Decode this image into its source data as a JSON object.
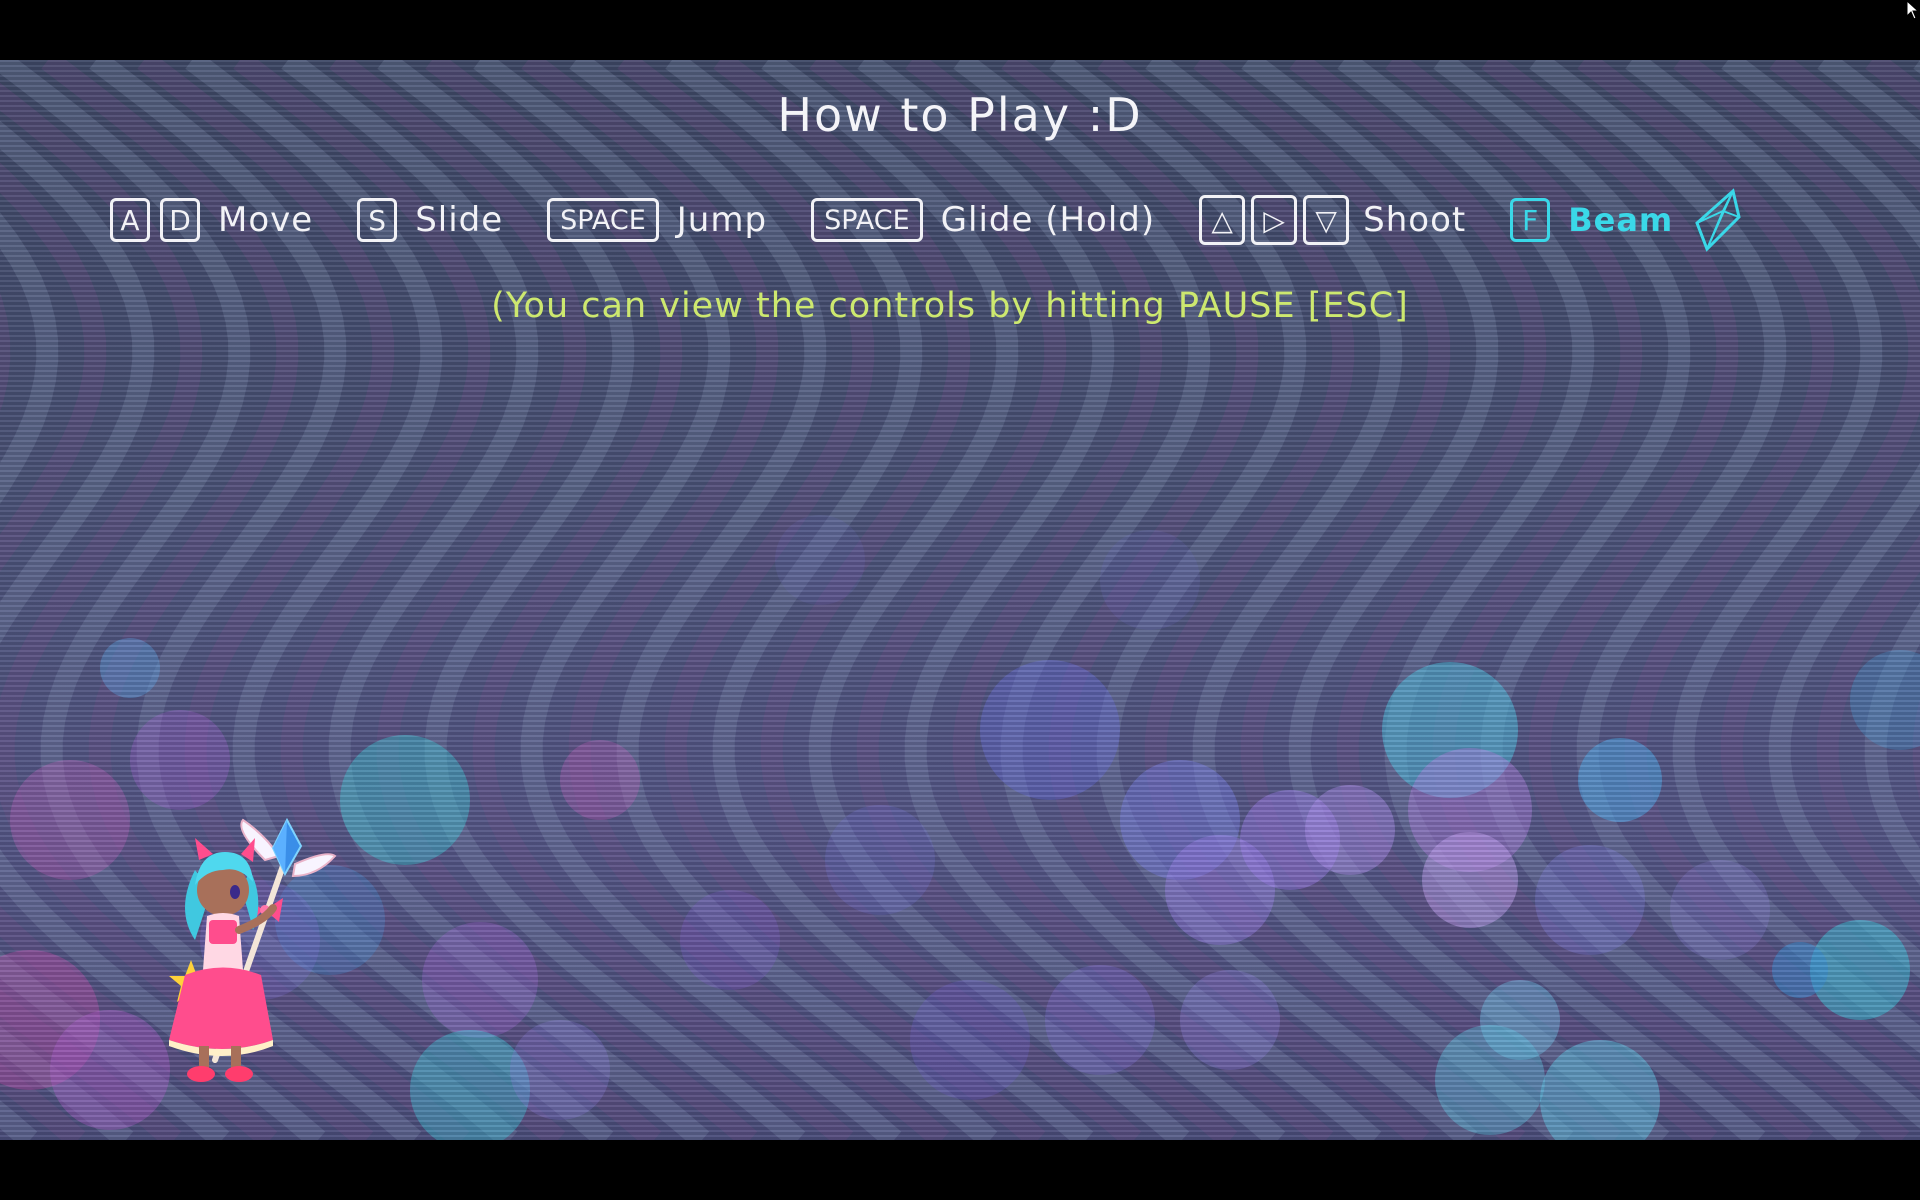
{
  "title": "How to Play :D",
  "controls": {
    "move": {
      "keys": [
        "A",
        "D"
      ],
      "label": "Move"
    },
    "slide": {
      "keys": [
        "S"
      ],
      "label": "Slide"
    },
    "jump": {
      "keys": [
        "SPACE"
      ],
      "label": "Jump"
    },
    "glide": {
      "keys": [
        "SPACE"
      ],
      "label": "Glide (Hold)"
    },
    "shoot": {
      "keys": [
        "△",
        "▷",
        "▽"
      ],
      "label": "Shoot"
    },
    "beam": {
      "keys": [
        "F"
      ],
      "label": "Beam",
      "icon": "crystal-icon"
    }
  },
  "hint": "(You can view the controls by hitting PAUSE [ESC]",
  "colors": {
    "text": "#f2f2f6",
    "hint": "#cde86f",
    "beam": "#3ad8e8",
    "background": "#4a5277"
  }
}
